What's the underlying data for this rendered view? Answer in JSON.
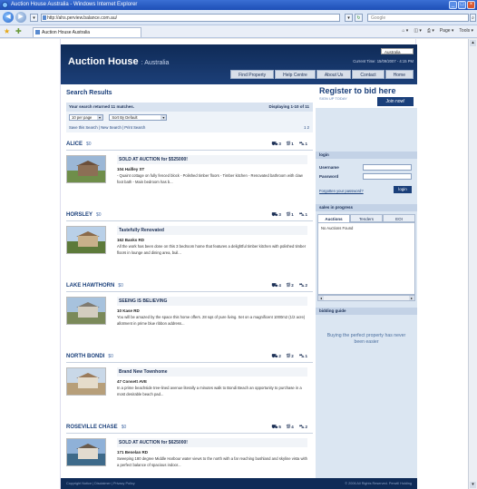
{
  "window": {
    "title": "Auction House Australia - Windows Internet Explorer"
  },
  "browser": {
    "address": "http://ahs.perview.balance.com.au/",
    "search_placeholder": "Google",
    "tab_label": "Auction House Australia",
    "tools": [
      "Page ▾",
      "Tools ▾"
    ]
  },
  "site": {
    "logo": "Auction House",
    "logo_sub": ": Australia",
    "region": "Australia",
    "current_time": "Current Time: 15/09/2007 - 4:15 PM",
    "nav": [
      "Find Property",
      "Help Centre",
      "About Us",
      "Contact",
      "Home"
    ]
  },
  "results": {
    "title": "Search Results",
    "count_text": "Your search returned 11 matches.",
    "displaying": "Displaying 1-10 of 11",
    "per_page": "10 per page",
    "sort": "Sort By Default",
    "links": "Save this Search | New Search | Print Search",
    "pages": "1 2"
  },
  "listings": [
    {
      "suburb": "ALICE",
      "price": "$0",
      "beds": "3",
      "baths": "1",
      "cars": "1",
      "headline": "SOLD AT AUCTION for $525000!",
      "address": "104 Hallley ST",
      "desc": "- Quaint cottage on fully fenced block - Polished timber floors - Timber kitchen - Renovated bathroom with claw foot bath - Main bedroom has b..."
    },
    {
      "suburb": "HORSLEY",
      "price": "$0",
      "beds": "3",
      "baths": "1",
      "cars": "1",
      "headline": "Tastefully Renovated",
      "address": "162 Banks RD",
      "desc": "All the work has been done on this 3 bedroom home that features a delightful timber kitchen with polished timber floors in lounge and dining area, buil..."
    },
    {
      "suburb": "LAKE HAWTHORN",
      "price": "$0",
      "beds": "4",
      "baths": "2",
      "cars": "2",
      "headline": "SEEING IS BELIEVING",
      "address": "10 Kase RD",
      "desc": "You will be amazed by the space this home offers. 28 sqs of pure living. Set on a magnificent 1000m2 (1/2 acre) allotment in prime blue ribbon address..."
    },
    {
      "suburb": "NORTH BONDI",
      "price": "$0",
      "beds": "2",
      "baths": "2",
      "cars": "1",
      "headline": "Brand New Townhome",
      "address": "47 Consett AVE",
      "desc": "In a prime beachside tree-lined avenue literally a minutes walk to Bondi Beach an opportunity to purchase in a most desirable beach pad..."
    },
    {
      "suburb": "ROSEVILLE CHASE",
      "price": "$0",
      "beds": "5",
      "baths": "4",
      "cars": "2",
      "headline": "SOLD AT AUCTION for $625000!",
      "address": "171 Benelan RD",
      "desc": "Sweeping 180 degree Middle Harbour water views to the north with a far reaching bushland and skyline vista with a perfect balance of spacious indoor..."
    }
  ],
  "sidebar": {
    "register_title": "Register to bid here",
    "register_sub": "SIGN UP TODAY",
    "join_label": "Join now!",
    "login_title": "login",
    "username_label": "Username",
    "password_label": "Password",
    "forgot": "Forgotten your password?",
    "login_button": "login",
    "sip_title": "sales in progress",
    "sip_tabs": [
      "Auctions",
      "Tenders",
      "EOI"
    ],
    "sip_empty": "No Auctions Found",
    "guide_title": "bidding guide",
    "guide_text": "Buying the perfect property has never been easier"
  },
  "footer": {
    "left": "Copyright Notice  |  Disclaimer  |  Privacy Policy",
    "right": "© 2006 All Rights Reserved. Perwill Holding"
  }
}
